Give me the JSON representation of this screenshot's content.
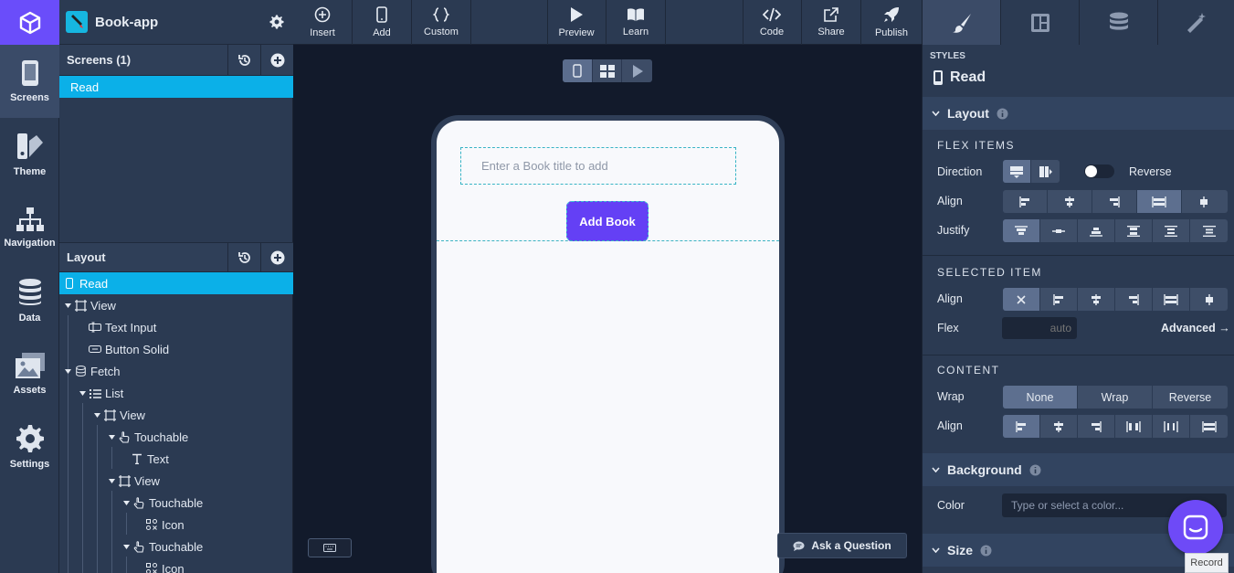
{
  "app": {
    "name": "Book-app"
  },
  "rail": {
    "items": [
      {
        "label": "Screens",
        "icon": "phone-icon"
      },
      {
        "label": "Theme",
        "icon": "palette-icon"
      },
      {
        "label": "Navigation",
        "icon": "sitemap-icon"
      },
      {
        "label": "Data",
        "icon": "database-icon"
      },
      {
        "label": "Assets",
        "icon": "images-icon"
      },
      {
        "label": "Settings",
        "icon": "gear-icon"
      }
    ]
  },
  "screens_panel": {
    "title": "Screens (1)",
    "items": [
      "Read"
    ]
  },
  "layout_panel": {
    "title": "Layout",
    "tree": [
      "Read",
      "View",
      "Text Input",
      "Button Solid",
      "Fetch",
      "List",
      "View",
      "Touchable",
      "Text",
      "View",
      "Touchable",
      "Icon",
      "Touchable",
      "Icon"
    ]
  },
  "toolbar": {
    "insert": "Insert",
    "add": "Add",
    "custom": "Custom",
    "preview": "Preview",
    "learn": "Learn",
    "code": "Code",
    "share": "Share",
    "publish": "Publish"
  },
  "canvas": {
    "input_placeholder": "Enter a Book title to add",
    "button_label": "Add Book",
    "ask_label": "Ask a Question"
  },
  "styles": {
    "caption": "STYLES",
    "screen_name": "Read",
    "layout_title": "Layout",
    "flex_items": "FLEX ITEMS",
    "direction_label": "Direction",
    "reverse_label": "Reverse",
    "align_label": "Align",
    "justify_label": "Justify",
    "selected_item": "SELECTED ITEM",
    "flex_label": "Flex",
    "flex_placeholder": "auto",
    "advanced": "Advanced →",
    "content": "CONTENT",
    "wrap_label": "Wrap",
    "wrap_options": [
      "None",
      "Wrap",
      "Reverse"
    ],
    "background_title": "Background",
    "color_label": "Color",
    "color_placeholder": "Type or select a color...",
    "size_title": "Size",
    "record": "Record"
  },
  "colors": {
    "accent": "#6a4dfa",
    "selection": "#0bb0e8",
    "panel": "#2b3a52",
    "canvas": "#121a2b"
  }
}
